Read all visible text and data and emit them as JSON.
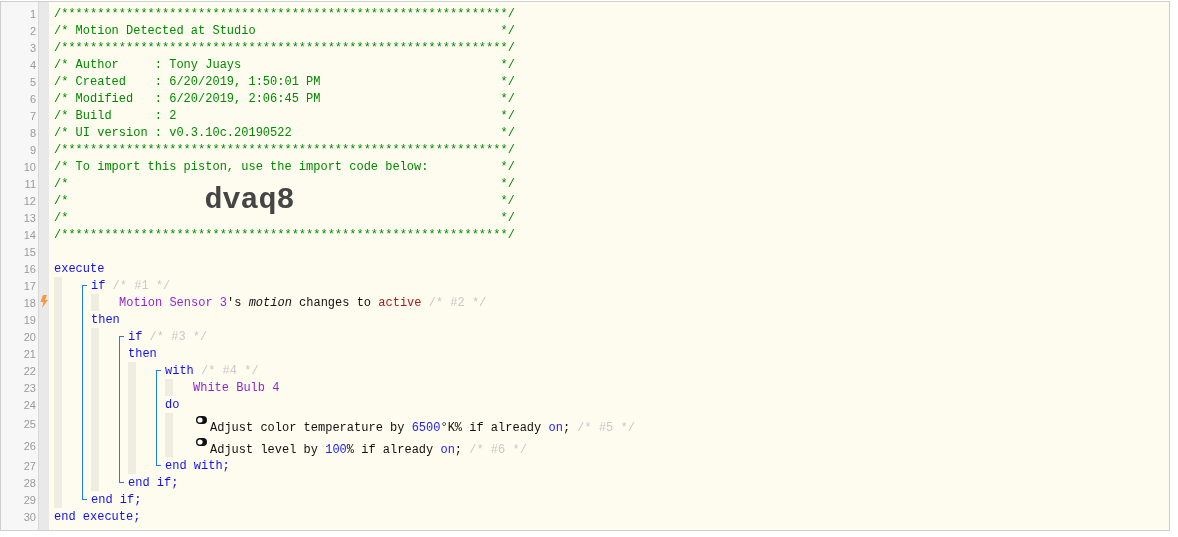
{
  "header": [
    {
      "number": "1",
      "trigger": false,
      "text": "/**************************************************************/"
    },
    {
      "number": "2",
      "trigger": false,
      "text": "/* Motion Detected at Studio                                  */"
    },
    {
      "number": "3",
      "trigger": false,
      "text": "/**************************************************************/"
    },
    {
      "number": "4",
      "trigger": false,
      "text": "/* Author     : Tony Juays                                    */"
    },
    {
      "number": "5",
      "trigger": false,
      "text": "/* Created    : 6/20/2019, 1:50:01 PM                         */"
    },
    {
      "number": "6",
      "trigger": false,
      "text": "/* Modified   : 6/20/2019, 2:06:45 PM                         */"
    },
    {
      "number": "7",
      "trigger": false,
      "text": "/* Build      : 2                                             */"
    },
    {
      "number": "8",
      "trigger": false,
      "text": "/* UI version : v0.3.10c.20190522                             */"
    },
    {
      "number": "9",
      "trigger": false,
      "text": "/**************************************************************/"
    },
    {
      "number": "10",
      "trigger": false,
      "text": "/* To import this piston, use the import code below:          */"
    },
    {
      "number": "11",
      "trigger": false,
      "text": "/*                                                            */"
    },
    {
      "number": "12",
      "trigger": false,
      "open": "/*",
      "import_code": "dvaq8",
      "close": "*/"
    },
    {
      "number": "13",
      "trigger": false,
      "text": "/*                                                            */"
    },
    {
      "number": "14",
      "trigger": false,
      "text": "/**************************************************************/"
    }
  ],
  "blank_line": {
    "number": "15",
    "trigger": false
  },
  "code": {
    "head": {
      "number": "16",
      "trigger": false,
      "segments": [
        {
          "kind": "keyword",
          "text": "execute"
        }
      ]
    },
    "parts": [
      {
        "body": [
          {
            "kind": "if",
            "head": {
              "number": "17",
              "trigger": false,
              "segments": [
                {
                  "kind": "keyword",
                  "text": "if "
                },
                {
                  "kind": "note",
                  "text": "/* #1 */"
                }
              ]
            },
            "parts": [
              {
                "body": [
                  {
                    "number": "18",
                    "trigger": true,
                    "segments": [
                      {
                        "kind": "device",
                        "text": "Motion Sensor 3"
                      },
                      {
                        "kind": "text",
                        "text": "'s "
                      },
                      {
                        "kind": "attribute",
                        "text": "motion"
                      },
                      {
                        "kind": "text",
                        "text": " changes to "
                      },
                      {
                        "kind": "value",
                        "text": "active"
                      },
                      {
                        "kind": "note",
                        "text": " /* #2 */"
                      }
                    ]
                  }
                ],
                "after": {
                  "number": "19",
                  "trigger": false,
                  "segments": [
                    {
                      "kind": "keyword",
                      "text": "then"
                    }
                  ]
                }
              },
              {
                "body": [
                  {
                    "kind": "if",
                    "head": {
                      "number": "20",
                      "trigger": false,
                      "segments": [
                        {
                          "kind": "keyword",
                          "text": "if "
                        },
                        {
                          "kind": "note",
                          "text": "/* #3 */"
                        }
                      ]
                    },
                    "parts": [
                      {
                        "after": {
                          "number": "21",
                          "trigger": false,
                          "segments": [
                            {
                              "kind": "keyword",
                              "text": "then"
                            }
                          ]
                        }
                      },
                      {
                        "body": [
                          {
                            "kind": "with",
                            "head": {
                              "number": "22",
                              "trigger": false,
                              "segments": [
                                {
                                  "kind": "keyword",
                                  "text": "with "
                                },
                                {
                                  "kind": "note",
                                  "text": "/* #4 */"
                                }
                              ]
                            },
                            "parts": [
                              {
                                "body": [
                                  {
                                    "number": "23",
                                    "trigger": false,
                                    "segments": [
                                      {
                                        "kind": "device",
                                        "text": "White Bulb 4"
                                      }
                                    ]
                                  }
                                ],
                                "after": {
                                  "number": "24",
                                  "trigger": false,
                                  "segments": [
                                    {
                                      "kind": "keyword",
                                      "text": "do"
                                    }
                                  ]
                                }
                              },
                              {
                                "body": [
                                  {
                                    "number": "25",
                                    "trigger": false,
                                    "kind": "action",
                                    "segments": [
                                      {
                                        "kind": "text",
                                        "text": "Adjust color temperature by "
                                      },
                                      {
                                        "kind": "number",
                                        "text": "6500"
                                      },
                                      {
                                        "kind": "text",
                                        "text": "°K% if already "
                                      },
                                      {
                                        "kind": "number",
                                        "text": "on"
                                      },
                                      {
                                        "kind": "text",
                                        "text": "; "
                                      },
                                      {
                                        "kind": "note",
                                        "text": "/* #5 */"
                                      }
                                    ]
                                  },
                                  {
                                    "number": "26",
                                    "trigger": false,
                                    "kind": "action",
                                    "segments": [
                                      {
                                        "kind": "text",
                                        "text": "Adjust level by "
                                      },
                                      {
                                        "kind": "number",
                                        "text": "100"
                                      },
                                      {
                                        "kind": "text",
                                        "text": "% if already "
                                      },
                                      {
                                        "kind": "number",
                                        "text": "on"
                                      },
                                      {
                                        "kind": "text",
                                        "text": "; "
                                      },
                                      {
                                        "kind": "note",
                                        "text": "/* #6 */"
                                      }
                                    ]
                                  }
                                ],
                                "after": {
                                  "number": "27",
                                  "trigger": false,
                                  "segments": [
                                    {
                                      "kind": "keyword",
                                      "text": "end with;"
                                    }
                                  ]
                                }
                              }
                            ]
                          }
                        ],
                        "after": {
                          "number": "28",
                          "trigger": false,
                          "segments": [
                            {
                              "kind": "keyword",
                              "text": "end if;"
                            }
                          ]
                        }
                      }
                    ]
                  }
                ],
                "after": {
                  "number": "29",
                  "trigger": false,
                  "segments": [
                    {
                      "kind": "keyword",
                      "text": "end if;"
                    }
                  ]
                }
              }
            ]
          }
        ],
        "after": {
          "number": "30",
          "trigger": false,
          "segments": [
            {
              "kind": "keyword",
              "text": "end execute;"
            }
          ]
        }
      }
    ]
  }
}
